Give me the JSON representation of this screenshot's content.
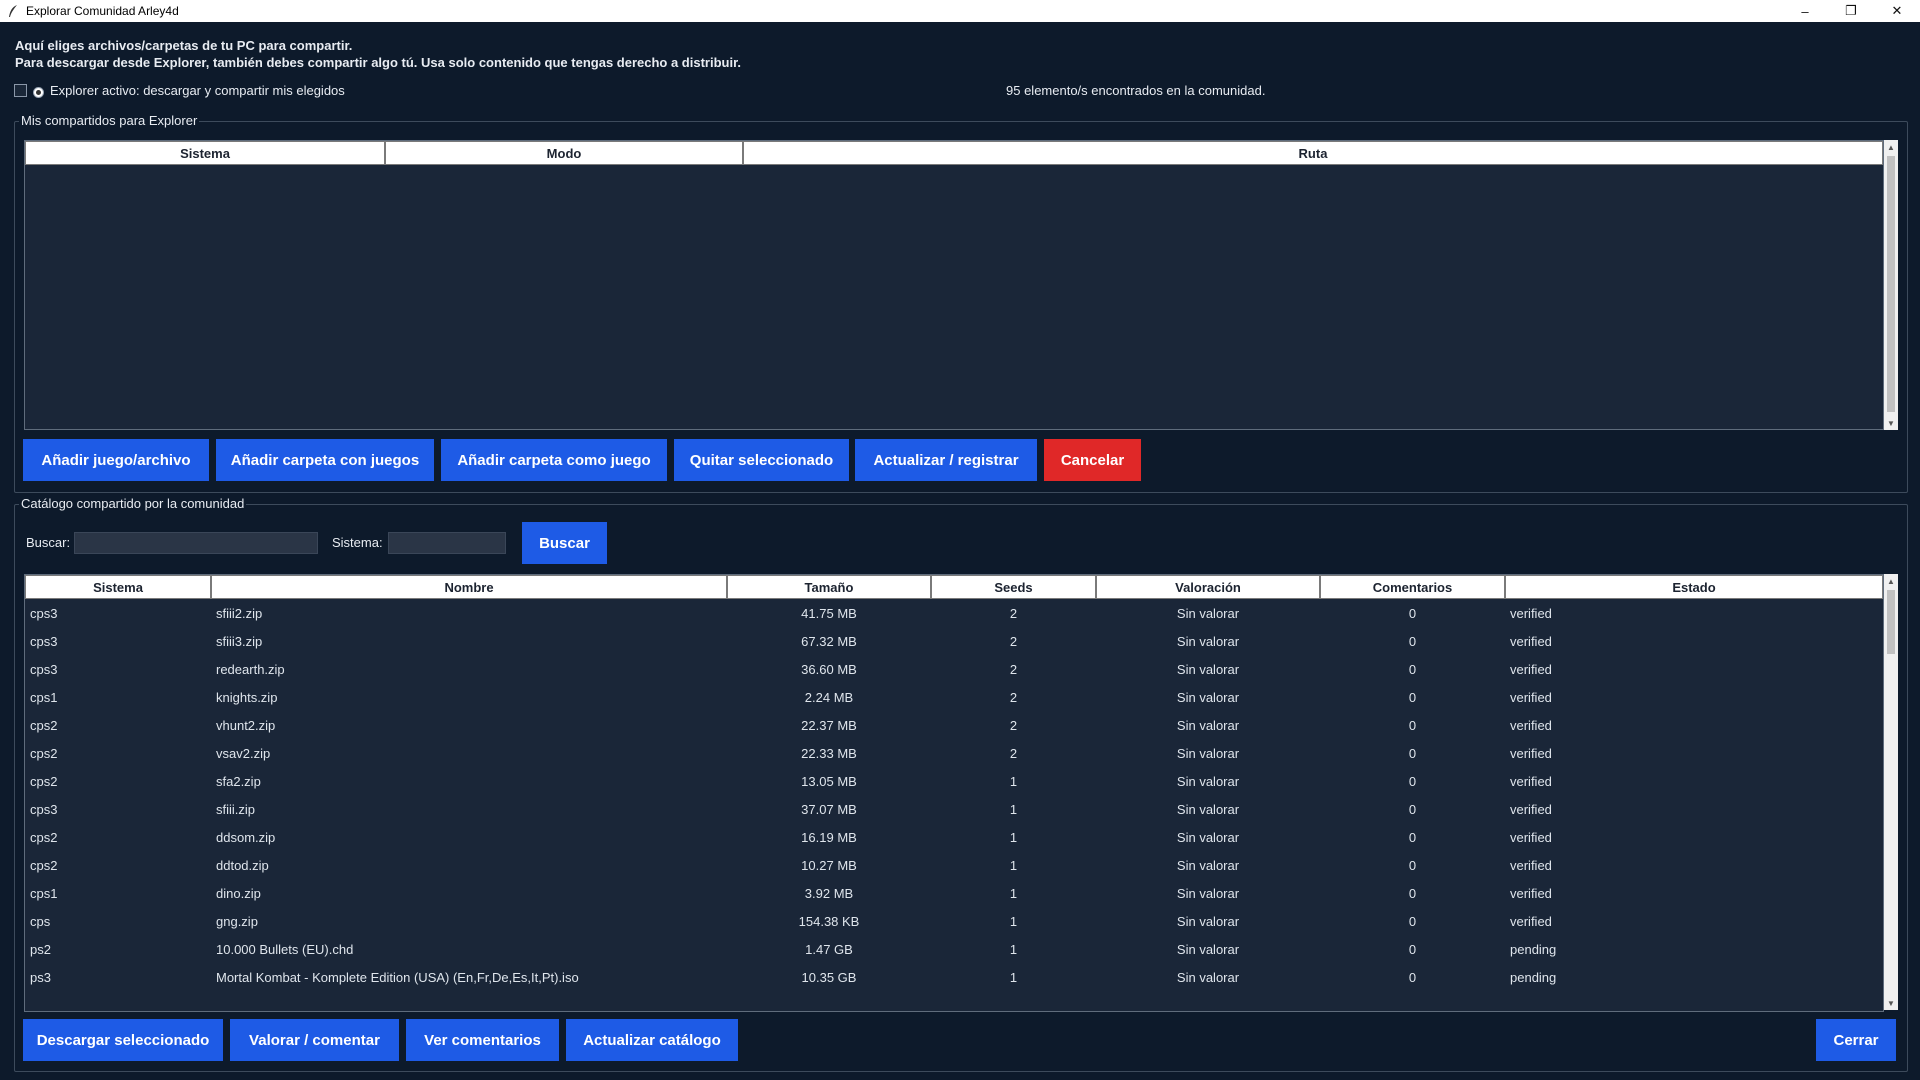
{
  "window": {
    "title": "Explorar Comunidad Arley4d"
  },
  "intro": {
    "line1": "Aquí eliges archivos/carpetas de tu PC para compartir.",
    "line2": "Para descargar desde Explorer, también debes compartir algo tú. Usa solo contenido que tengas derecho a distribuir."
  },
  "explorer_toggle": {
    "label": "Explorer activo: descargar y compartir mis elegidos"
  },
  "found_text": "95 elemento/s encontrados en la comunidad.",
  "my_shares": {
    "group_label": "Mis compartidos para Explorer",
    "columns": [
      "Sistema",
      "Modo",
      "Ruta"
    ],
    "buttons": {
      "add_file": "Añadir juego/archivo",
      "add_folder_games": "Añadir carpeta con juegos",
      "add_folder_as_game": "Añadir carpeta como juego",
      "remove_selected": "Quitar seleccionado",
      "update_register": "Actualizar / registrar",
      "cancel": "Cancelar"
    }
  },
  "catalog": {
    "group_label": "Catálogo compartido por la comunidad",
    "search_label": "Buscar:",
    "system_label": "Sistema:",
    "search_value": "",
    "system_value": "",
    "search_button": "Buscar",
    "columns": [
      "Sistema",
      "Nombre",
      "Tamaño",
      "Seeds",
      "Valoración",
      "Comentarios",
      "Estado"
    ],
    "rows": [
      [
        "cps3",
        "sfiii2.zip",
        "41.75 MB",
        "2",
        "Sin valorar",
        "0",
        "verified"
      ],
      [
        "cps3",
        "sfiii3.zip",
        "67.32 MB",
        "2",
        "Sin valorar",
        "0",
        "verified"
      ],
      [
        "cps3",
        "redearth.zip",
        "36.60 MB",
        "2",
        "Sin valorar",
        "0",
        "verified"
      ],
      [
        "cps1",
        "knights.zip",
        "2.24 MB",
        "2",
        "Sin valorar",
        "0",
        "verified"
      ],
      [
        "cps2",
        "vhunt2.zip",
        "22.37 MB",
        "2",
        "Sin valorar",
        "0",
        "verified"
      ],
      [
        "cps2",
        "vsav2.zip",
        "22.33 MB",
        "2",
        "Sin valorar",
        "0",
        "verified"
      ],
      [
        "cps2",
        "sfa2.zip",
        "13.05 MB",
        "1",
        "Sin valorar",
        "0",
        "verified"
      ],
      [
        "cps3",
        "sfiii.zip",
        "37.07 MB",
        "1",
        "Sin valorar",
        "0",
        "verified"
      ],
      [
        "cps2",
        "ddsom.zip",
        "16.19 MB",
        "1",
        "Sin valorar",
        "0",
        "verified"
      ],
      [
        "cps2",
        "ddtod.zip",
        "10.27 MB",
        "1",
        "Sin valorar",
        "0",
        "verified"
      ],
      [
        "cps1",
        "dino.zip",
        "3.92 MB",
        "1",
        "Sin valorar",
        "0",
        "verified"
      ],
      [
        "cps",
        "gng.zip",
        "154.38 KB",
        "1",
        "Sin valorar",
        "0",
        "verified"
      ],
      [
        "ps2",
        "10.000 Bullets (EU).chd",
        "1.47 GB",
        "1",
        "Sin valorar",
        "0",
        "pending"
      ],
      [
        "ps3",
        "Mortal Kombat - Komplete Edition (USA) (En,Fr,De,Es,It,Pt).iso",
        "10.35 GB",
        "1",
        "Sin valorar",
        "0",
        "pending"
      ]
    ],
    "buttons": {
      "download": "Descargar seleccionado",
      "rate": "Valorar / comentar",
      "view_comments": "Ver comentarios",
      "refresh_catalog": "Actualizar catálogo",
      "close": "Cerrar"
    }
  },
  "colors": {
    "background": "#0d1a2b",
    "accent": "#1e5be6",
    "danger": "#e02828",
    "table_bg": "#1a2638"
  }
}
